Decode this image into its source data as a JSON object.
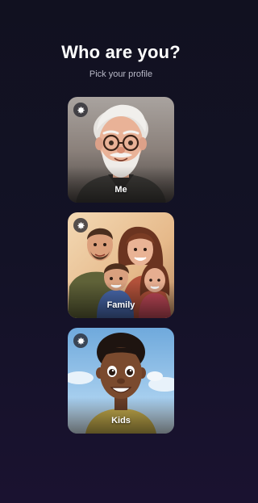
{
  "header": {
    "title": "Who are you?",
    "subtitle": "Pick your profile"
  },
  "profiles": [
    {
      "label": "Me",
      "icon": "gear-icon"
    },
    {
      "label": "Family",
      "icon": "gear-icon"
    },
    {
      "label": "Kids",
      "icon": "gear-icon"
    }
  ],
  "colors": {
    "background": "#121124",
    "card_me_bg": "#8a7f78",
    "card_family_bg": "#e2b98a",
    "card_kids_bg": "#8fc0e6"
  }
}
